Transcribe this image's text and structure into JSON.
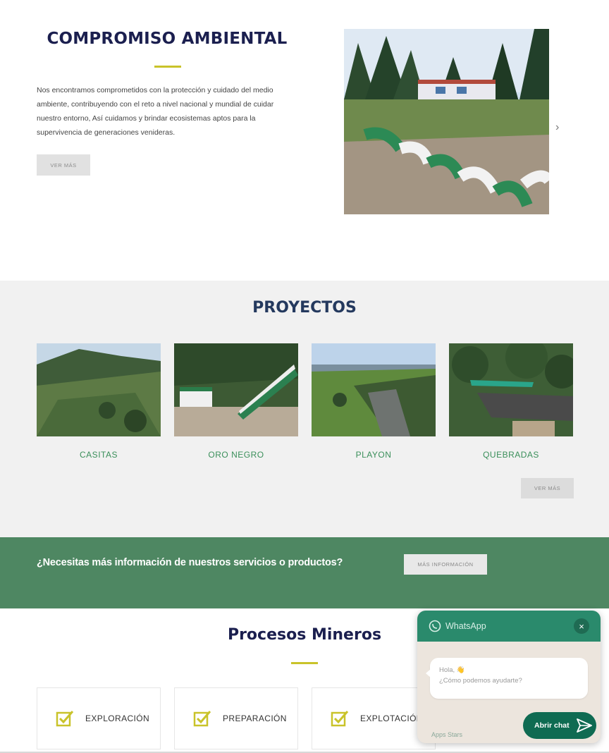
{
  "environment": {
    "title": "COMPROMISO AMBIENTAL",
    "text": "Nos encontramos comprometidos con la protección y cuidado del medio ambiente,  contribuyendo con el reto a nivel nacional y mundial de cuidar nuestro entorno,  Así cuidamos y brindar ecosistemas aptos para la supervivencia de generaciones venideras.",
    "button_label": "VER MÁS",
    "next_arrow": "›"
  },
  "projects": {
    "title": "PROYECTOS",
    "items": [
      {
        "label": "CASITAS"
      },
      {
        "label": "ORO NEGRO"
      },
      {
        "label": "PLAYON"
      },
      {
        "label": "QUEBRADAS"
      }
    ],
    "button_label": "VER MÁS"
  },
  "cta": {
    "text": "¿Necesitas más información de nuestros servicios o productos?",
    "button_label": "MÁS INFORMACIÓN"
  },
  "processes": {
    "title": "Procesos Mineros",
    "items": [
      {
        "label": "EXPLORACIÓN",
        "icon": "checkbox-icon"
      },
      {
        "label": "PREPARACIÓN",
        "icon": "checkbox-icon"
      },
      {
        "label": "EXPLOTACIÓN",
        "icon": "checkbox-icon"
      }
    ]
  },
  "whatsapp": {
    "title": "WhatsApp",
    "close": "×",
    "greeting": "Hola, 👋",
    "question": "¿Cómo podemos ayudarte?",
    "open_label": "Abrir chat",
    "brand": "Apps Stars"
  },
  "colors": {
    "title_navy": "#1b1f4f",
    "accent_yellow": "#c9c32a",
    "section_grey": "#f1f1f1",
    "cta_green": "#4e8762",
    "project_label_green": "#3a8f5a",
    "whatsapp_green": "#2a8a6c"
  }
}
